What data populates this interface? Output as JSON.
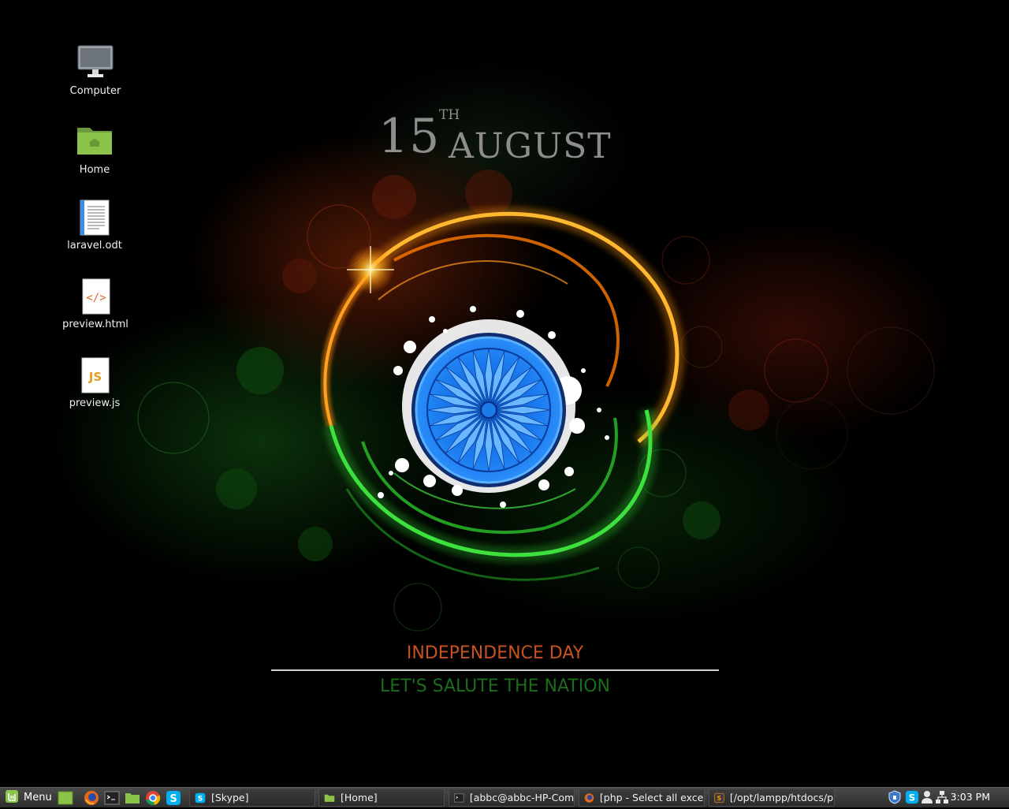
{
  "wallpaper": {
    "day": "15",
    "superscript": "TH",
    "month": "AUGUST",
    "title": "INDEPENDENCE DAY",
    "subtitle": "LET'S SALUTE THE NATION"
  },
  "desktop_icons": [
    {
      "label": "Computer",
      "icon": "computer-icon"
    },
    {
      "label": "Home",
      "icon": "home-folder-icon"
    },
    {
      "label": "laravel.odt",
      "icon": "document-icon"
    },
    {
      "label": "preview.html",
      "icon": "html-file-icon"
    },
    {
      "label": "preview.js",
      "icon": "js-file-icon"
    }
  ],
  "taskbar": {
    "menu_label": "Menu",
    "launchers": [
      "show-desktop-icon",
      "firefox-icon",
      "terminal-icon",
      "files-icon",
      "chrome-icon",
      "skype-icon"
    ],
    "tasks": [
      {
        "label": "[Skype]",
        "icon": "skype-icon"
      },
      {
        "label": "[Home]",
        "icon": "folder-icon"
      },
      {
        "label": "[abbc@abbc-HP-Com...",
        "icon": "terminal-icon"
      },
      {
        "label": "[php - Select all exce...",
        "icon": "firefox-icon"
      },
      {
        "label": "[/opt/lampp/htdocs/p...",
        "icon": "sublime-icon"
      }
    ],
    "tray": [
      "shield-icon",
      "skype-icon",
      "user-icon",
      "network-icon"
    ],
    "clock": "3:03 PM"
  },
  "colors": {
    "saffron": "#f08a12",
    "green": "#2fb82f",
    "chakra_blue": "#1976e8",
    "taskbar": "#3a3a3a"
  }
}
